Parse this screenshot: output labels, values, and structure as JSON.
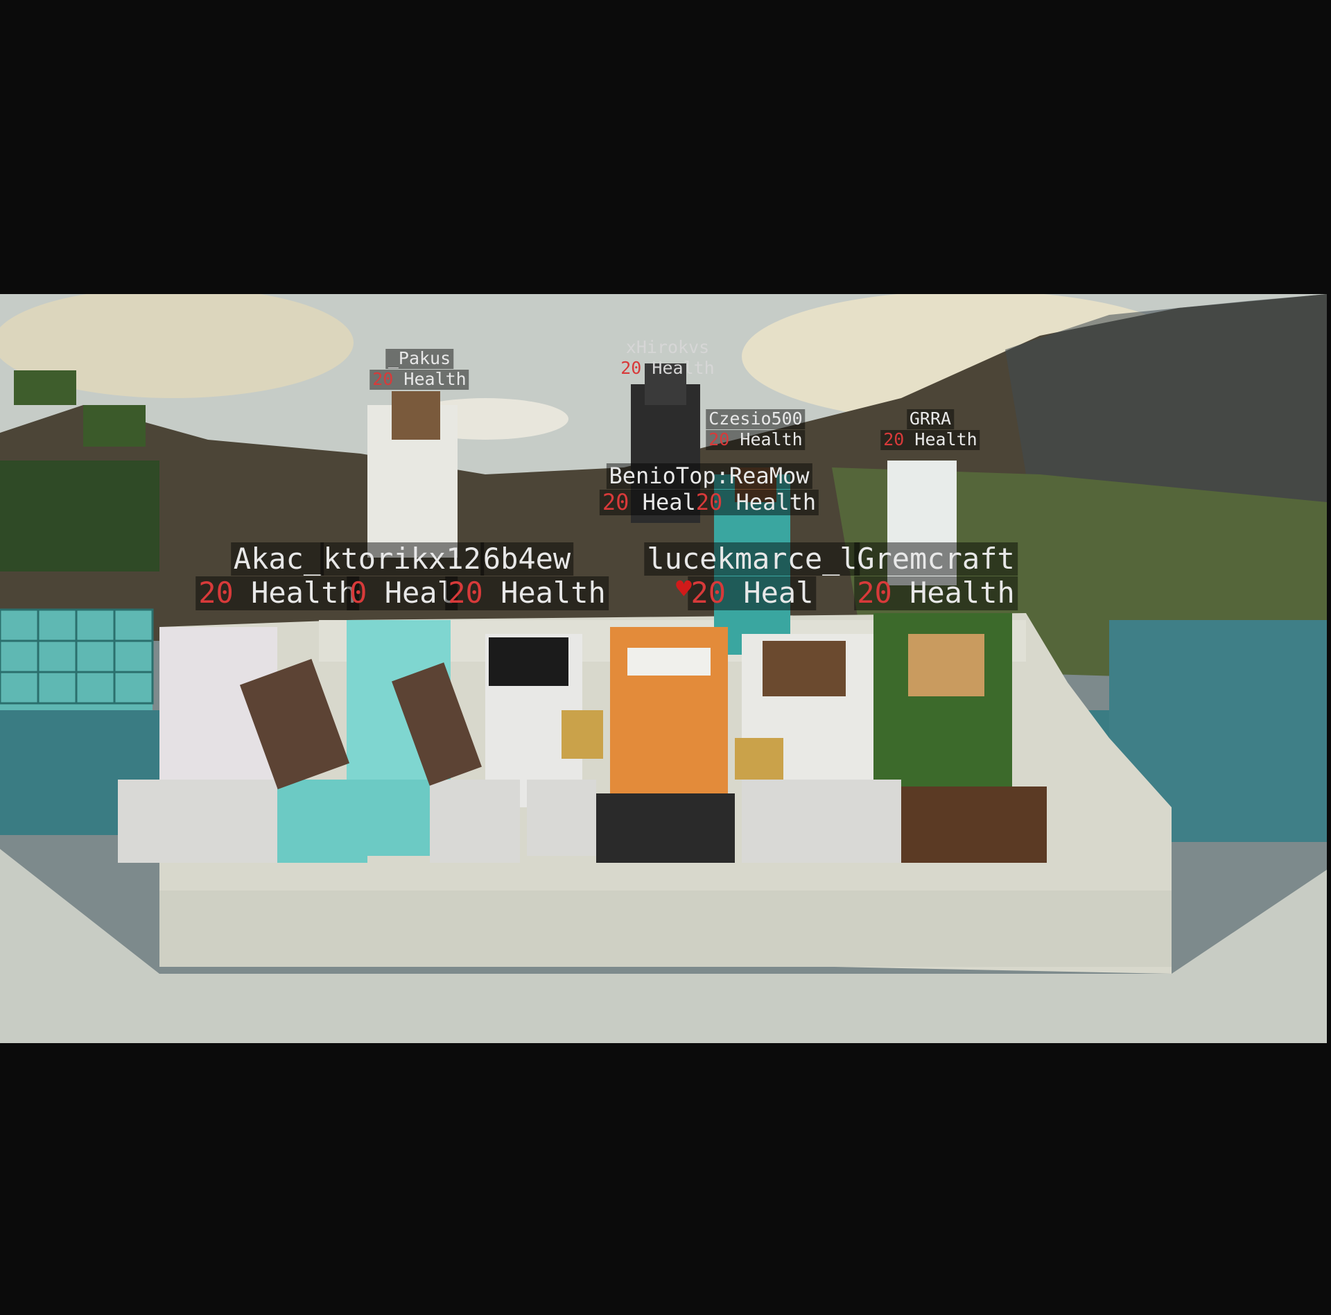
{
  "scene": {
    "description_colors": {
      "sky": "#c9cfc8",
      "cloud": "#e9e4cf",
      "mountain": "#4a4436",
      "water": "#3d7f86",
      "quartz": "#dcdcd2",
      "diamond": "#7fd6d0"
    }
  },
  "nametags": [
    {
      "name": "_Pakus",
      "health_value": "20",
      "health_label": "Health"
    },
    {
      "name": "xHirokvs",
      "health_value": "20",
      "health_label": "Health"
    },
    {
      "name": "Czesio500",
      "health_value": "20",
      "health_label": "Health"
    },
    {
      "name": "GRRA",
      "health_value": "20",
      "health_label": "Health"
    },
    {
      "name": "BenioTop:ReaMow",
      "health_value": "20",
      "health_label": "Heal"
    },
    {
      "name": "",
      "health_value": "20",
      "health_label": "Health"
    },
    {
      "name": "Akac_",
      "health_value": "20",
      "health_label": "Health"
    },
    {
      "name": "ktorikx12",
      "health_value": "0",
      "health_label": "Heal"
    },
    {
      "name": "6b4ew",
      "health_value": "20",
      "health_label": "Health"
    },
    {
      "name": "lucekmarce_l",
      "health_value": "20",
      "health_label": "Heal"
    },
    {
      "name": "Gremcraft",
      "health_value": "20",
      "health_label": "Health"
    }
  ]
}
